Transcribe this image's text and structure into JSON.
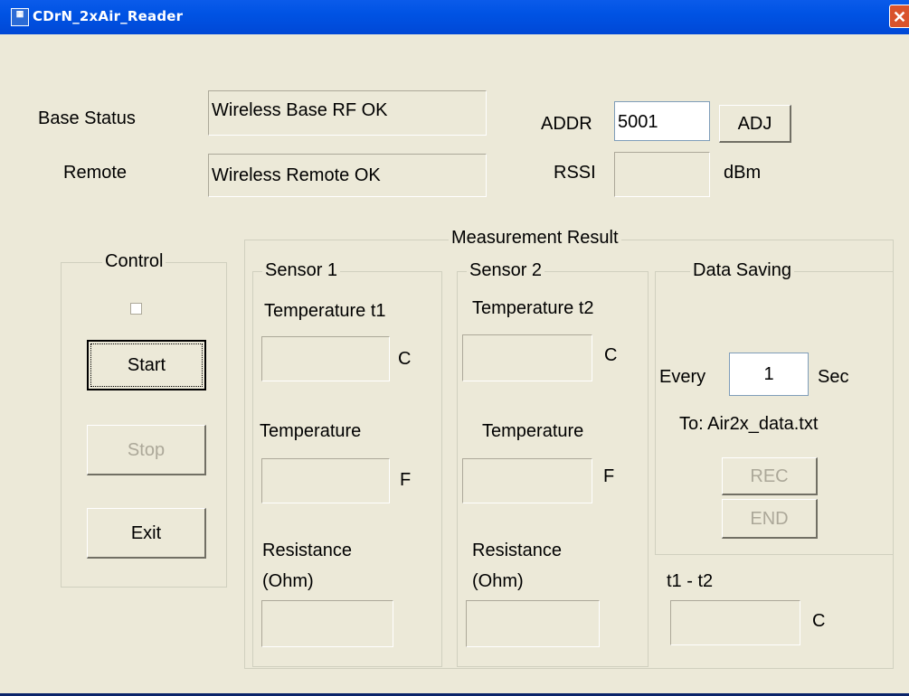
{
  "window": {
    "title": "CDrN_2xAir_Reader",
    "icon_glyph": "app-icon",
    "close_glyph": "✕"
  },
  "base": {
    "base_status_label": "Base Status",
    "base_status_value": "Wireless Base RF OK",
    "remote_label": "Remote",
    "remote_value": "Wireless Remote OK",
    "addr_label": "ADDR",
    "addr_value": "5001",
    "adj_label": "ADJ",
    "rssi_label": "RSSI",
    "rssi_value": "",
    "rssi_unit": "dBm"
  },
  "control": {
    "legend": "Control",
    "start_label": "Start",
    "stop_label": "Stop",
    "exit_label": "Exit"
  },
  "measurement": {
    "legend": "Measurement Result",
    "sensor1": {
      "legend": "Sensor 1",
      "temp_c_label": "Temperature t1",
      "temp_c_unit": "C",
      "temp_f_label": "Temperature",
      "temp_f_unit": "F",
      "resistance_label_1": "Resistance",
      "resistance_label_2": "(Ohm)"
    },
    "sensor2": {
      "legend": "Sensor 2",
      "temp_c_label": "Temperature t2",
      "temp_c_unit": "C",
      "temp_f_label": "Temperature",
      "temp_f_unit": "F",
      "resistance_label_1": "Resistance",
      "resistance_label_2": "(Ohm)"
    },
    "data_saving": {
      "legend": "Data Saving",
      "every_label": "Every",
      "interval_value": "1",
      "sec_label": "Sec",
      "to_label": "To: Air2x_data.txt",
      "rec_label": "REC",
      "end_label": "END"
    },
    "diff": {
      "label": "t1 - t2",
      "unit": "C"
    }
  },
  "colors": {
    "face": "#ECE9D8",
    "titlebar": "#0053E4",
    "disabled_text": "#ACA899"
  }
}
